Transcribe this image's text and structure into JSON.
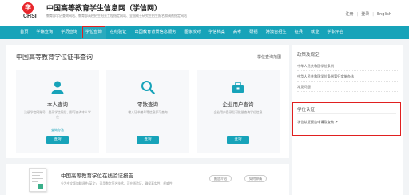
{
  "header": {
    "title": "中国高等教育学生信息网（学信网）",
    "subtitle": "教育部学历查询网站、教育部高校招生阳光工程指定网站、全国硕士研究生招生报名和调剂指定网站",
    "logo_text": "CHSI",
    "toplinks": [
      "注册",
      "登录",
      "English"
    ]
  },
  "nav": {
    "items": [
      "首页",
      "学籍查询",
      "学历查询",
      "学位查询",
      "在线验证",
      "出国教育背景信息服务",
      "图像校对",
      "学信档案",
      "高考",
      "研招",
      "港澳台招生",
      "征兵",
      "就业",
      "学职平台"
    ],
    "highlighted_index": 3
  },
  "main": {
    "title": "中国高等教育学位证书查询",
    "scope_link": "学位查询范围",
    "cards": [
      {
        "title": "本人查询",
        "desc": "注册学信网账号，登录学信网后，即可查询本人学位",
        "link": "查询办法",
        "button": "查询",
        "icon": "person-icon"
      },
      {
        "title": "零散查询",
        "desc": "输入证书编号等信息即可查询",
        "link": "",
        "button": "查询",
        "icon": "magnifier-icon"
      },
      {
        "title": "企业用户查询",
        "desc": "企业用户登录后可批量查询学位信息",
        "link": "",
        "button": "查询",
        "icon": "enterprise-icon"
      }
    ]
  },
  "report": {
    "title": "中国高等教育学位在线验证报告",
    "desc": "分为中文版和翻译件(英文)，采用数字签名技术，可在线验证，确保真实性、权威性",
    "buttons": [
      "报告介绍",
      "如何申请"
    ]
  },
  "sidebar": {
    "policy_head": "政策及规定",
    "policy_items": [
      "中华人民共和国学位条例",
      "中华人民共和国学位条例暂行实施办法",
      "常见问题"
    ],
    "cert_head": "学位认证",
    "cert_link": "学位认证报告申请及查询 >"
  },
  "colors": {
    "accent": "#17a3b9",
    "highlight": "#e02020",
    "logo_red": "#e8262b"
  }
}
